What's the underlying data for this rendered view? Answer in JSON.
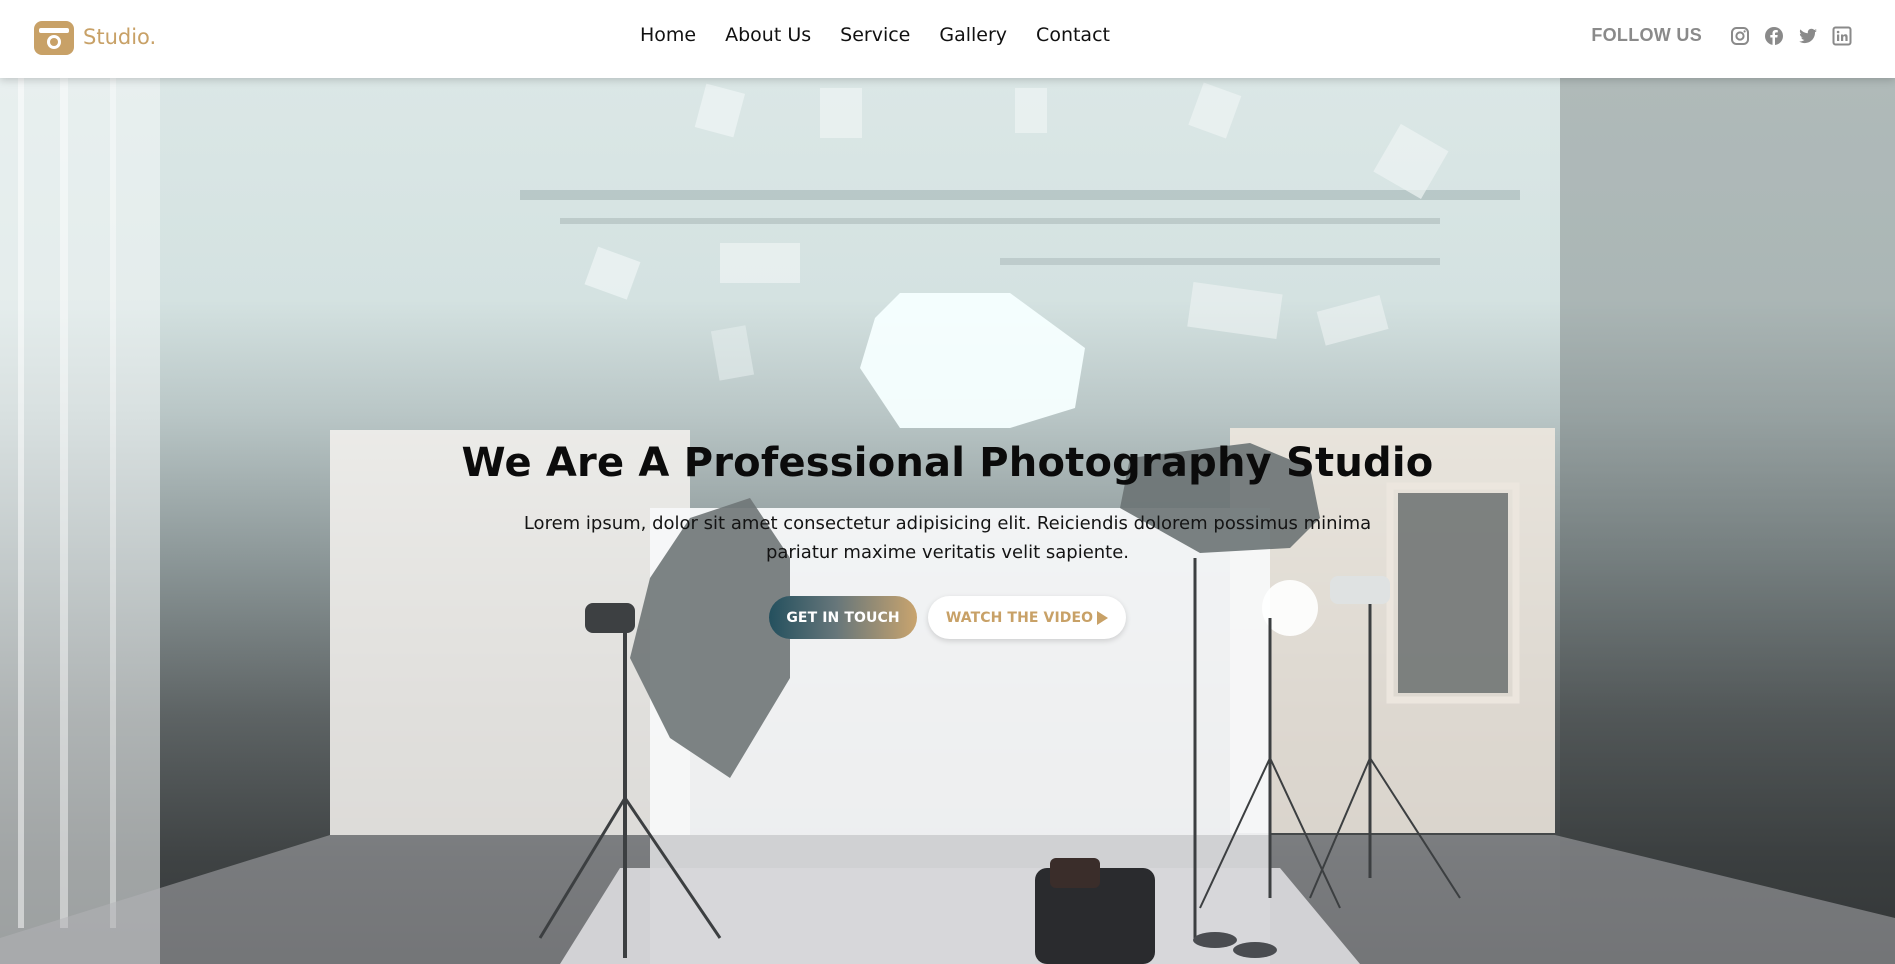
{
  "brand": {
    "name": "Studio.",
    "icon": "camera-icon",
    "accent_color": "#c8a167"
  },
  "nav": {
    "items": [
      {
        "label": "Home"
      },
      {
        "label": "About Us"
      },
      {
        "label": "Service"
      },
      {
        "label": "Gallery"
      },
      {
        "label": "Contact"
      }
    ]
  },
  "social": {
    "label": "FOLLOW US",
    "icons": [
      "instagram-icon",
      "facebook-icon",
      "twitter-icon",
      "linkedin-icon"
    ]
  },
  "hero": {
    "title": "We Are A Professional Photography Studio",
    "text": "Lorem ipsum, dolor sit amet consectetur adipisicing elit. Reiciendis dolorem possimus minima pariatur maxime veritatis velit sapiente.",
    "primary_button": "GET IN TOUCH",
    "secondary_button": "WATCH THE VIDEO",
    "secondary_icon": "play-icon",
    "background": "studio-photo"
  }
}
